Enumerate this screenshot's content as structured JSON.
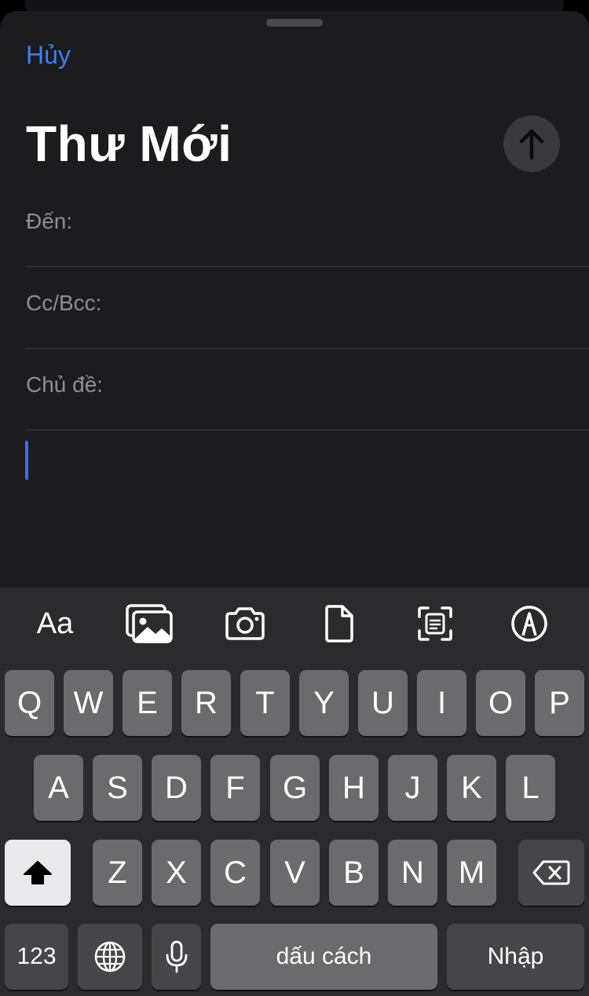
{
  "sheet": {
    "cancel_label": "Hủy",
    "title": "Thư Mới",
    "send_icon": "arrow-up-icon"
  },
  "fields": [
    {
      "label": "Đến:",
      "value": ""
    },
    {
      "label": "Cc/Bcc:",
      "value": ""
    },
    {
      "label": "Chủ đề:",
      "value": ""
    }
  ],
  "body": {
    "text": ""
  },
  "toolbar": {
    "format_label": "Aa",
    "icons": [
      "photo-library-icon",
      "camera-icon",
      "document-icon",
      "scan-document-icon",
      "markup-icon"
    ]
  },
  "keyboard": {
    "row1": [
      "Q",
      "W",
      "E",
      "R",
      "T",
      "Y",
      "U",
      "I",
      "O",
      "P"
    ],
    "row2": [
      "A",
      "S",
      "D",
      "F",
      "G",
      "H",
      "J",
      "K",
      "L"
    ],
    "row3": [
      "Z",
      "X",
      "C",
      "V",
      "B",
      "N",
      "M"
    ],
    "numbers_label": "123",
    "space_label": "dấu cách",
    "return_label": "Nhập"
  },
  "colors": {
    "accent": "#3b82f6",
    "sheet_background": "#1c1c1e",
    "keyboard_background": "#2b2b2d"
  }
}
